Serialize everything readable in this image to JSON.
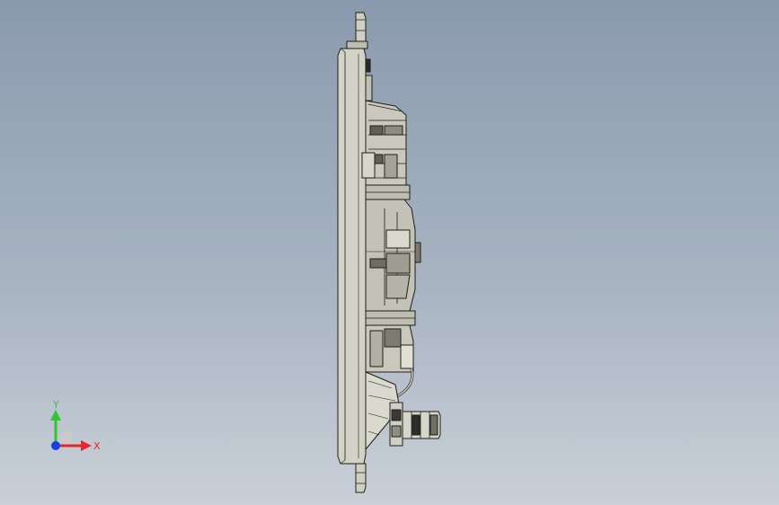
{
  "triad": {
    "x_label": "X",
    "y_label": "Y",
    "x_color": "#e8262a",
    "y_color": "#2fc62f",
    "z_color": "#1a3fe0"
  },
  "colors": {
    "background_top": "#8a9aae",
    "background_bottom": "#c9d0d8",
    "part_fill": "#cfcfc3",
    "part_shade": "#a9a99c",
    "part_dark": "#6f6f66",
    "edge": "#1f1f1a"
  }
}
